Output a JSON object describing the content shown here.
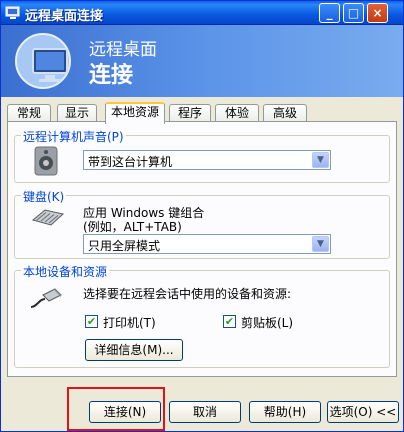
{
  "window": {
    "title": "远程桌面连接",
    "minimize": "_",
    "maximize": "□",
    "close": "×"
  },
  "banner": {
    "line1": "远程桌面",
    "line2": "连接"
  },
  "tabs": [
    "常规",
    "显示",
    "本地资源",
    "程序",
    "体验",
    "高级"
  ],
  "active_tab": "本地资源",
  "sound_group": {
    "label": "远程计算机声音(P)",
    "selected": "带到这台计算机"
  },
  "keyboard_group": {
    "label": "键盘(K)",
    "desc_line1": "应用 Windows 键组合",
    "desc_line2": "(例如，ALT+TAB)",
    "selected": "只用全屏模式"
  },
  "devices_group": {
    "label": "本地设备和资源",
    "desc": "选择要在远程会话中使用的设备和资源:",
    "printer_label": "打印机(T)",
    "printer_checked": true,
    "clipboard_label": "剪贴板(L)",
    "clipboard_checked": true,
    "details_button": "详细信息(M)..."
  },
  "buttons": {
    "connect": "连接(N)",
    "cancel": "取消",
    "help": "帮助(H)",
    "options": "选项(O) <<"
  },
  "colors": {
    "group_label": "#0046d5",
    "highlight_box": "#e01414",
    "titlebar": "#0858e0"
  }
}
